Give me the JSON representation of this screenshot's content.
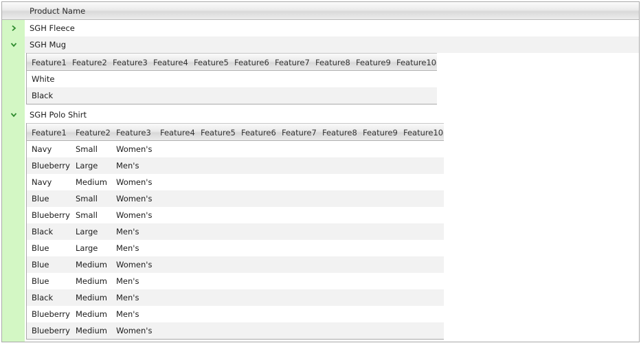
{
  "header": {
    "product_name": "Product Name"
  },
  "products": [
    {
      "name": "SGH Fleece",
      "expanded": false
    },
    {
      "name": "SGH Mug",
      "expanded": true
    },
    {
      "name": "SGH Polo Shirt",
      "expanded": true
    }
  ],
  "mug_table": {
    "columns": [
      "Feature1",
      "Feature2",
      "Feature3",
      "Feature4",
      "Feature5",
      "Feature6",
      "Feature7",
      "Feature8",
      "Feature9",
      "Feature10"
    ],
    "rows": [
      [
        "White"
      ],
      [
        "Black"
      ]
    ]
  },
  "polo_table": {
    "columns": [
      "Feature1",
      "Feature2",
      "Feature3",
      "Feature4",
      "Feature5",
      "Feature6",
      "Feature7",
      "Feature8",
      "Feature9",
      "Feature10"
    ],
    "rows": [
      [
        "Navy",
        "Small",
        "Women's"
      ],
      [
        "Blueberry",
        "Large",
        "Men's"
      ],
      [
        "Navy",
        "Medium",
        "Women's"
      ],
      [
        "Blue",
        "Small",
        "Women's"
      ],
      [
        "Blueberry",
        "Small",
        "Women's"
      ],
      [
        "Black",
        "Large",
        "Men's"
      ],
      [
        "Blue",
        "Large",
        "Men's"
      ],
      [
        "Blue",
        "Medium",
        "Women's"
      ],
      [
        "Blue",
        "Medium",
        "Men's"
      ],
      [
        "Black",
        "Medium",
        "Men's"
      ],
      [
        "Blueberry",
        "Medium",
        "Men's"
      ],
      [
        "Blueberry",
        "Medium",
        "Women's"
      ]
    ]
  },
  "colors": {
    "gutter": "#d3f7c4",
    "toggle": "#2e8b2e",
    "alt_row": "#f2f2f2"
  }
}
